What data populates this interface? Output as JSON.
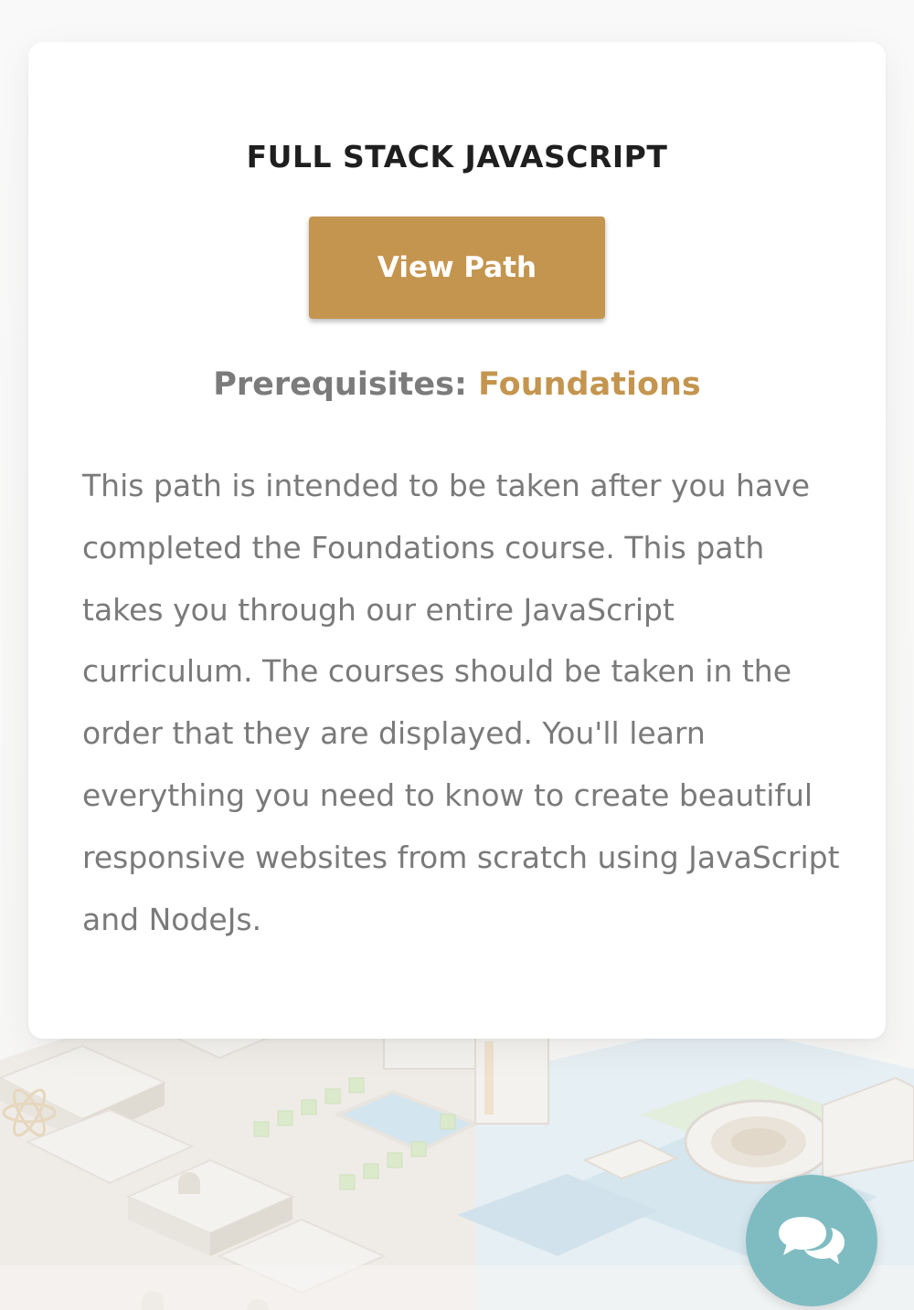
{
  "card": {
    "title": "FULL STACK JAVASCRIPT",
    "button_label": "View Path",
    "prerequisites_label": "Prerequisites:",
    "prerequisites_link": "Foundations",
    "description": "This path is intended to be taken after you have completed the Foundations course. This path takes you through our entire JavaScript curriculum. The courses should be taken in the order that they are displayed. You'll learn everything you need to know to create beautiful responsive websites from scratch using JavaScript and NodeJs."
  },
  "chat": {
    "icon": "chat-bubbles-icon"
  },
  "colors": {
    "accent": "#c4954f",
    "title_text": "#1f1f1f",
    "body_text": "#7a7a7a",
    "chat_button": "#7fbcc2"
  }
}
